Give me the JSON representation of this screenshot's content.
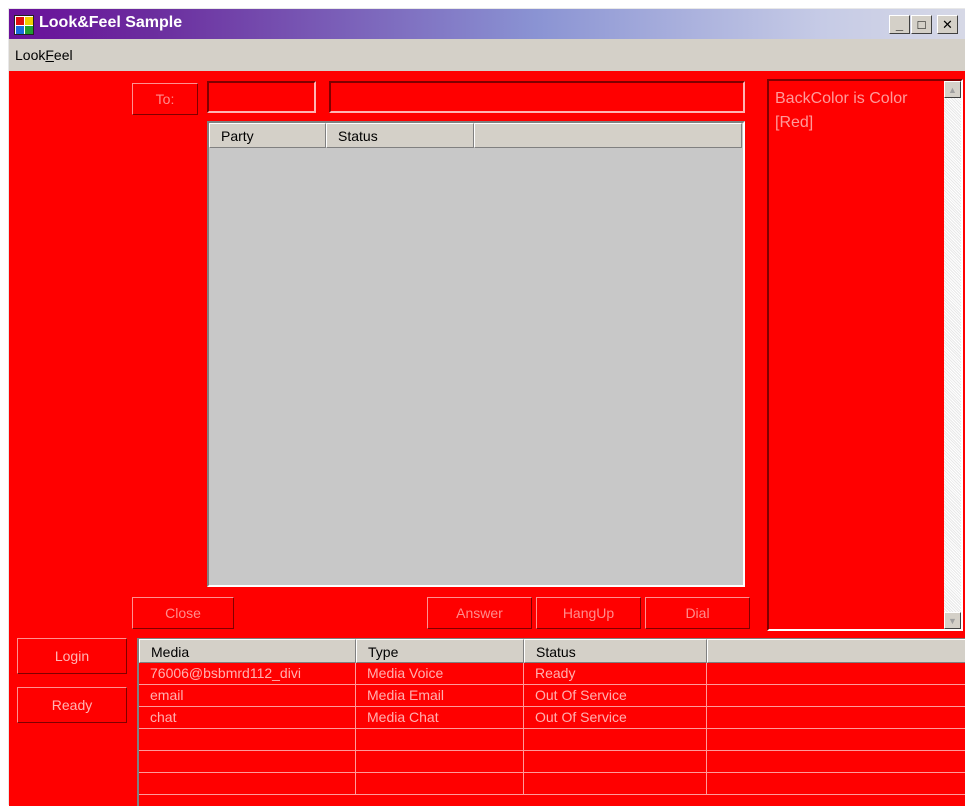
{
  "window": {
    "title": "Look&Feel Sample",
    "controls": {
      "minimize": "_",
      "maximize": "□",
      "close": "✕"
    }
  },
  "menu": {
    "items": [
      {
        "label": "LookFeel",
        "mnemonic": "F"
      }
    ]
  },
  "call_panel": {
    "to_label": "To:",
    "to_field_1": "",
    "to_field_2": "",
    "party_list": {
      "columns": [
        "Party",
        "Status",
        ""
      ],
      "rows": []
    },
    "buttons": {
      "close": "Close",
      "answer": "Answer",
      "hangup": "HangUp",
      "dial": "Dial"
    }
  },
  "info_box": {
    "text": "BackColor is Color [Red]"
  },
  "side_buttons": {
    "login": "Login",
    "ready": "Ready"
  },
  "media_grid": {
    "columns": [
      "Media",
      "Type",
      "Status",
      ""
    ],
    "rows": [
      [
        "76006@bsbmrd112_divi",
        "Media Voice",
        "Ready",
        ""
      ],
      [
        "email",
        "Media Email",
        "Out Of Service",
        ""
      ],
      [
        "chat",
        "Media Chat",
        "Out Of Service",
        ""
      ],
      [
        "",
        "",
        "",
        ""
      ],
      [
        "",
        "",
        "",
        ""
      ],
      [
        "",
        "",
        "",
        ""
      ]
    ]
  },
  "colors": {
    "back_color": "#ff0000",
    "title_gradient_start": "#6a0f9a",
    "title_gradient_end": "#d6d8e6",
    "disabled_text": "#ff8c8c"
  }
}
